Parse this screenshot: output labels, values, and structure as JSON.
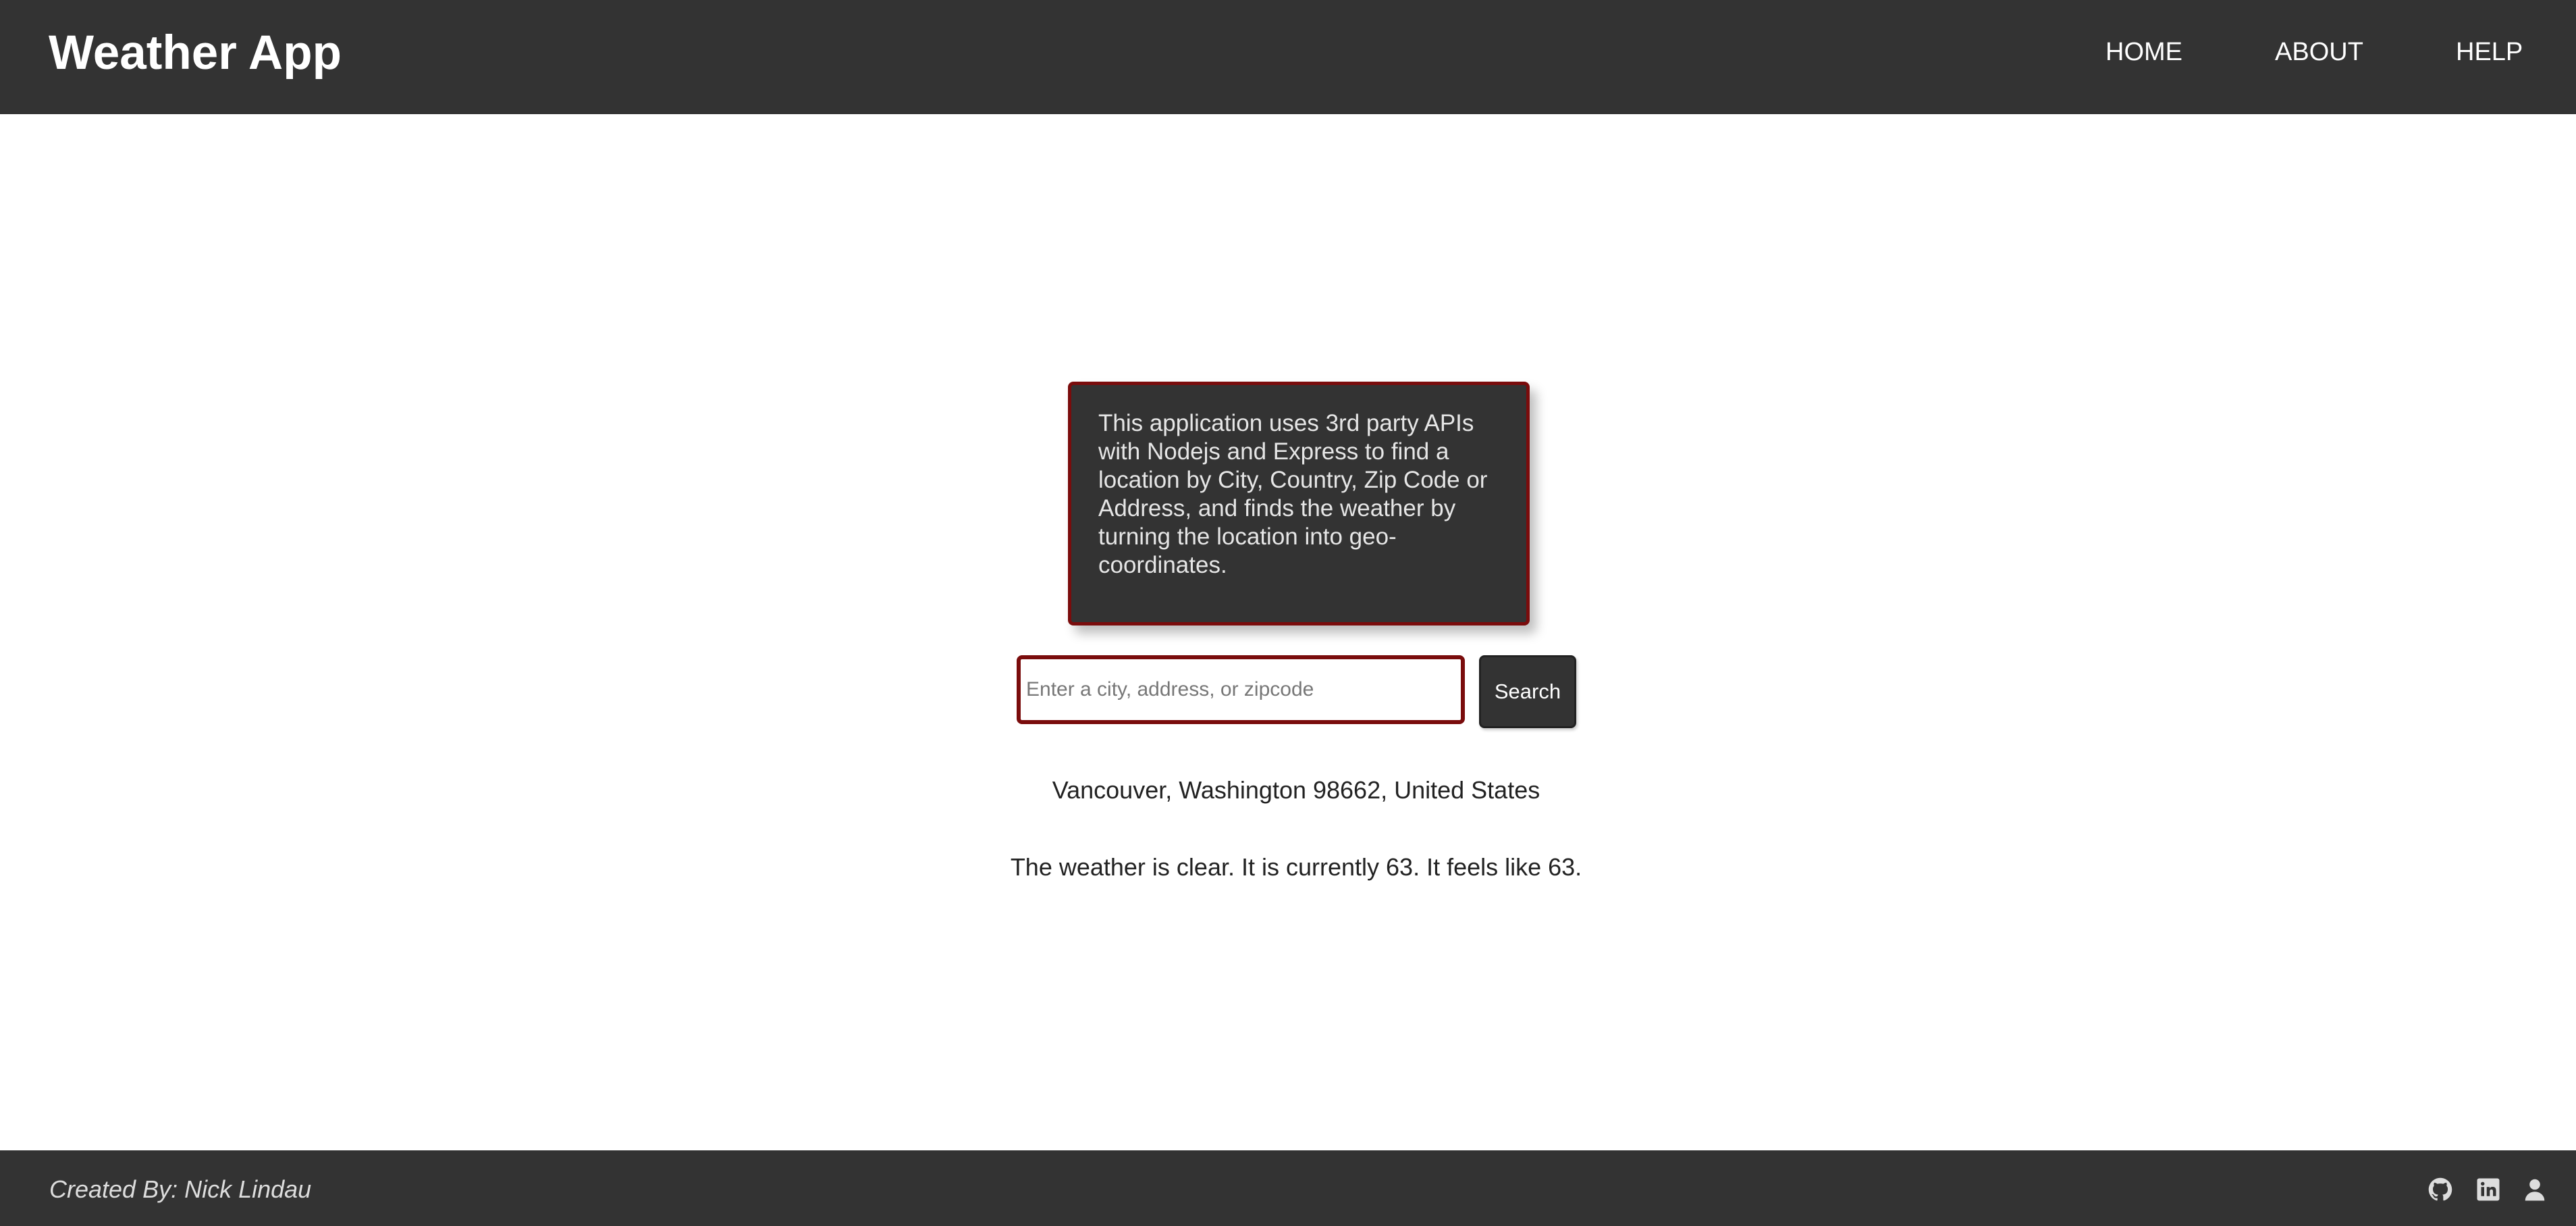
{
  "header": {
    "brand": "Weather App",
    "nav": {
      "home": "HOME",
      "about": "ABOUT",
      "help": "HELP"
    }
  },
  "info_card": {
    "text": "This application uses 3rd party APIs with Nodejs and Express to find a location by City, Country, Zip Code or Address, and finds the weather by turning the location into geo-coordinates."
  },
  "search": {
    "value": "",
    "placeholder": "Enter a city, address, or zipcode",
    "button_label": "Search"
  },
  "result": {
    "location": "Vancouver, Washington 98662, United States",
    "forecast": "The weather is clear. It is currently 63. It feels like 63."
  },
  "footer": {
    "credit": "Created By: Nick Lindau",
    "icons": [
      "github-icon",
      "linkedin-icon",
      "user-icon"
    ]
  },
  "colors": {
    "header_bg": "#333333",
    "accent_border": "#7a0c0c",
    "card_text": "#e6e6e6"
  }
}
